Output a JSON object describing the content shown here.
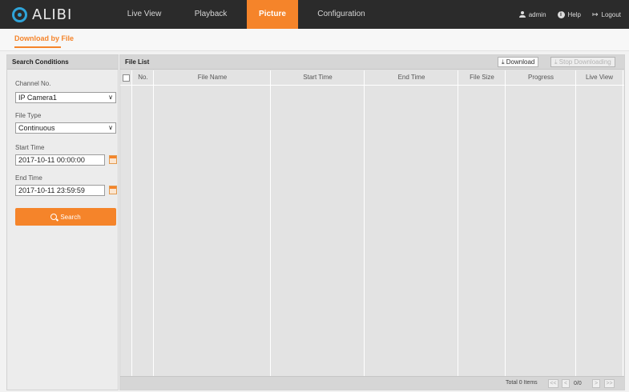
{
  "header": {
    "logo_text": "ALIBI",
    "nav": [
      {
        "label": "Live View",
        "active": false
      },
      {
        "label": "Playback",
        "active": false
      },
      {
        "label": "Picture",
        "active": true
      },
      {
        "label": "Configuration",
        "active": false
      }
    ],
    "user": {
      "name": "admin",
      "help": "Help",
      "logout": "Logout"
    },
    "accent_color": "#f5842a"
  },
  "subtab": {
    "label": "Download by File"
  },
  "search": {
    "title": "Search Conditions",
    "channel_label": "Channel No.",
    "channel_value": "IP Camera1",
    "filetype_label": "File Type",
    "filetype_value": "Continuous",
    "start_label": "Start Time",
    "start_value": "2017-10-11 00:00:00",
    "end_label": "End Time",
    "end_value": "2017-10-11 23:59:59",
    "button_label": "Search"
  },
  "filelist": {
    "title": "File List",
    "download_label": "Download",
    "stop_label": "Stop Downloading",
    "columns": [
      "No.",
      "File Name",
      "Start Time",
      "End Time",
      "File Size",
      "Progress",
      "Live View"
    ],
    "rows": [],
    "footer": {
      "total": "Total 0 Items",
      "first": "<<",
      "prev": "<",
      "page": "0/0",
      "next": ">",
      "last": ">>"
    }
  }
}
